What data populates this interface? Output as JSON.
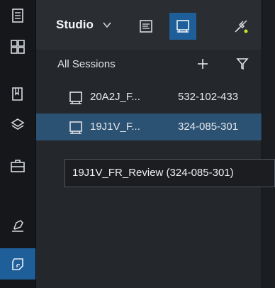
{
  "rail": {
    "items": [
      {
        "name": "document-icon",
        "active": false
      },
      {
        "name": "grid-icon",
        "active": false
      },
      {
        "name": "book-icon",
        "active": false
      },
      {
        "name": "layers-icon",
        "active": false
      },
      {
        "name": "briefcase-icon",
        "active": false
      },
      {
        "name": "pen-tool-icon",
        "active": false
      },
      {
        "name": "cube-icon",
        "active": true
      }
    ]
  },
  "header": {
    "title": "Studio",
    "accent_color": "#1f5f99",
    "status_dot_color": "#c6e52c"
  },
  "sessions": {
    "title": "All Sessions",
    "items": [
      {
        "name": "20A2J_F...",
        "id": "532-102-433",
        "selected": false
      },
      {
        "name": "19J1V_F...",
        "id": "324-085-301",
        "selected": true
      }
    ]
  },
  "tooltip": {
    "text": "19J1V_FR_Review (324-085-301)"
  }
}
